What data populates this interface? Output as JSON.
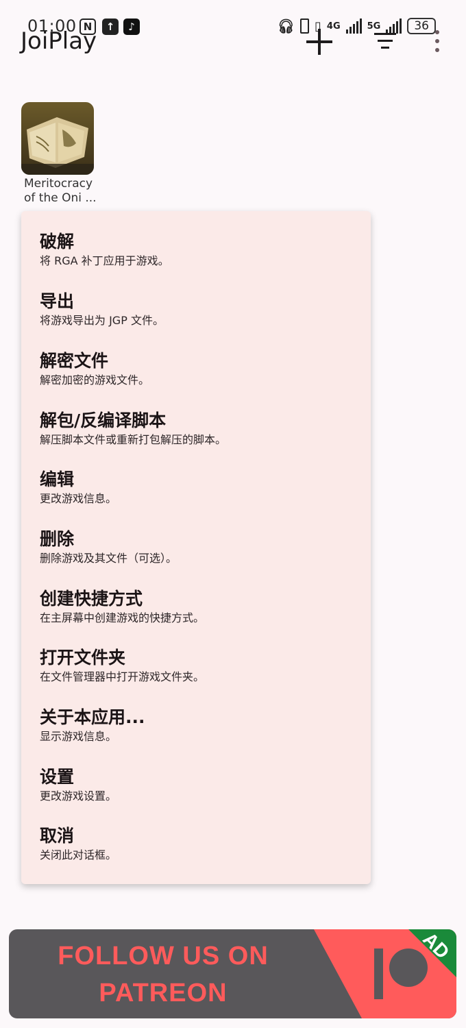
{
  "status_bar": {
    "time": "01:00",
    "network_4g": "4G",
    "network_5g": "5G",
    "battery": "36"
  },
  "app_bar": {
    "title": "JoiPlay"
  },
  "game": {
    "name_line1": "Meritocracy",
    "name_line2": "of the Oni ..."
  },
  "menu": {
    "items": [
      {
        "title": "破解",
        "desc": "将 RGA 补丁应用于游戏。"
      },
      {
        "title": "导出",
        "desc": "将游戏导出为 JGP 文件。"
      },
      {
        "title": "解密文件",
        "desc": "解密加密的游戏文件。"
      },
      {
        "title": "解包/反编译脚本",
        "desc": "解压脚本文件或重新打包解压的脚本。"
      },
      {
        "title": "编辑",
        "desc": "更改游戏信息。"
      },
      {
        "title": "删除",
        "desc": "删除游戏及其文件（可选）。"
      },
      {
        "title": "创建快捷方式",
        "desc": "在主屏幕中创建游戏的快捷方式。"
      },
      {
        "title": "打开文件夹",
        "desc": "在文件管理器中打开游戏文件夹。"
      },
      {
        "title": "关于本应用...",
        "desc": "显示游戏信息。"
      },
      {
        "title": "设置",
        "desc": "更改游戏设置。"
      },
      {
        "title": "取消",
        "desc": "关闭此对话框。"
      }
    ]
  },
  "ad": {
    "line1": "FOLLOW US ON",
    "line2": "PATREON",
    "badge": "AD"
  },
  "colors": {
    "background": "#fcf8fa",
    "dialog": "#fbeae8",
    "ad_bg": "#59575a",
    "ad_accent": "#ff5b5b",
    "ad_badge": "#1a8a3a"
  }
}
